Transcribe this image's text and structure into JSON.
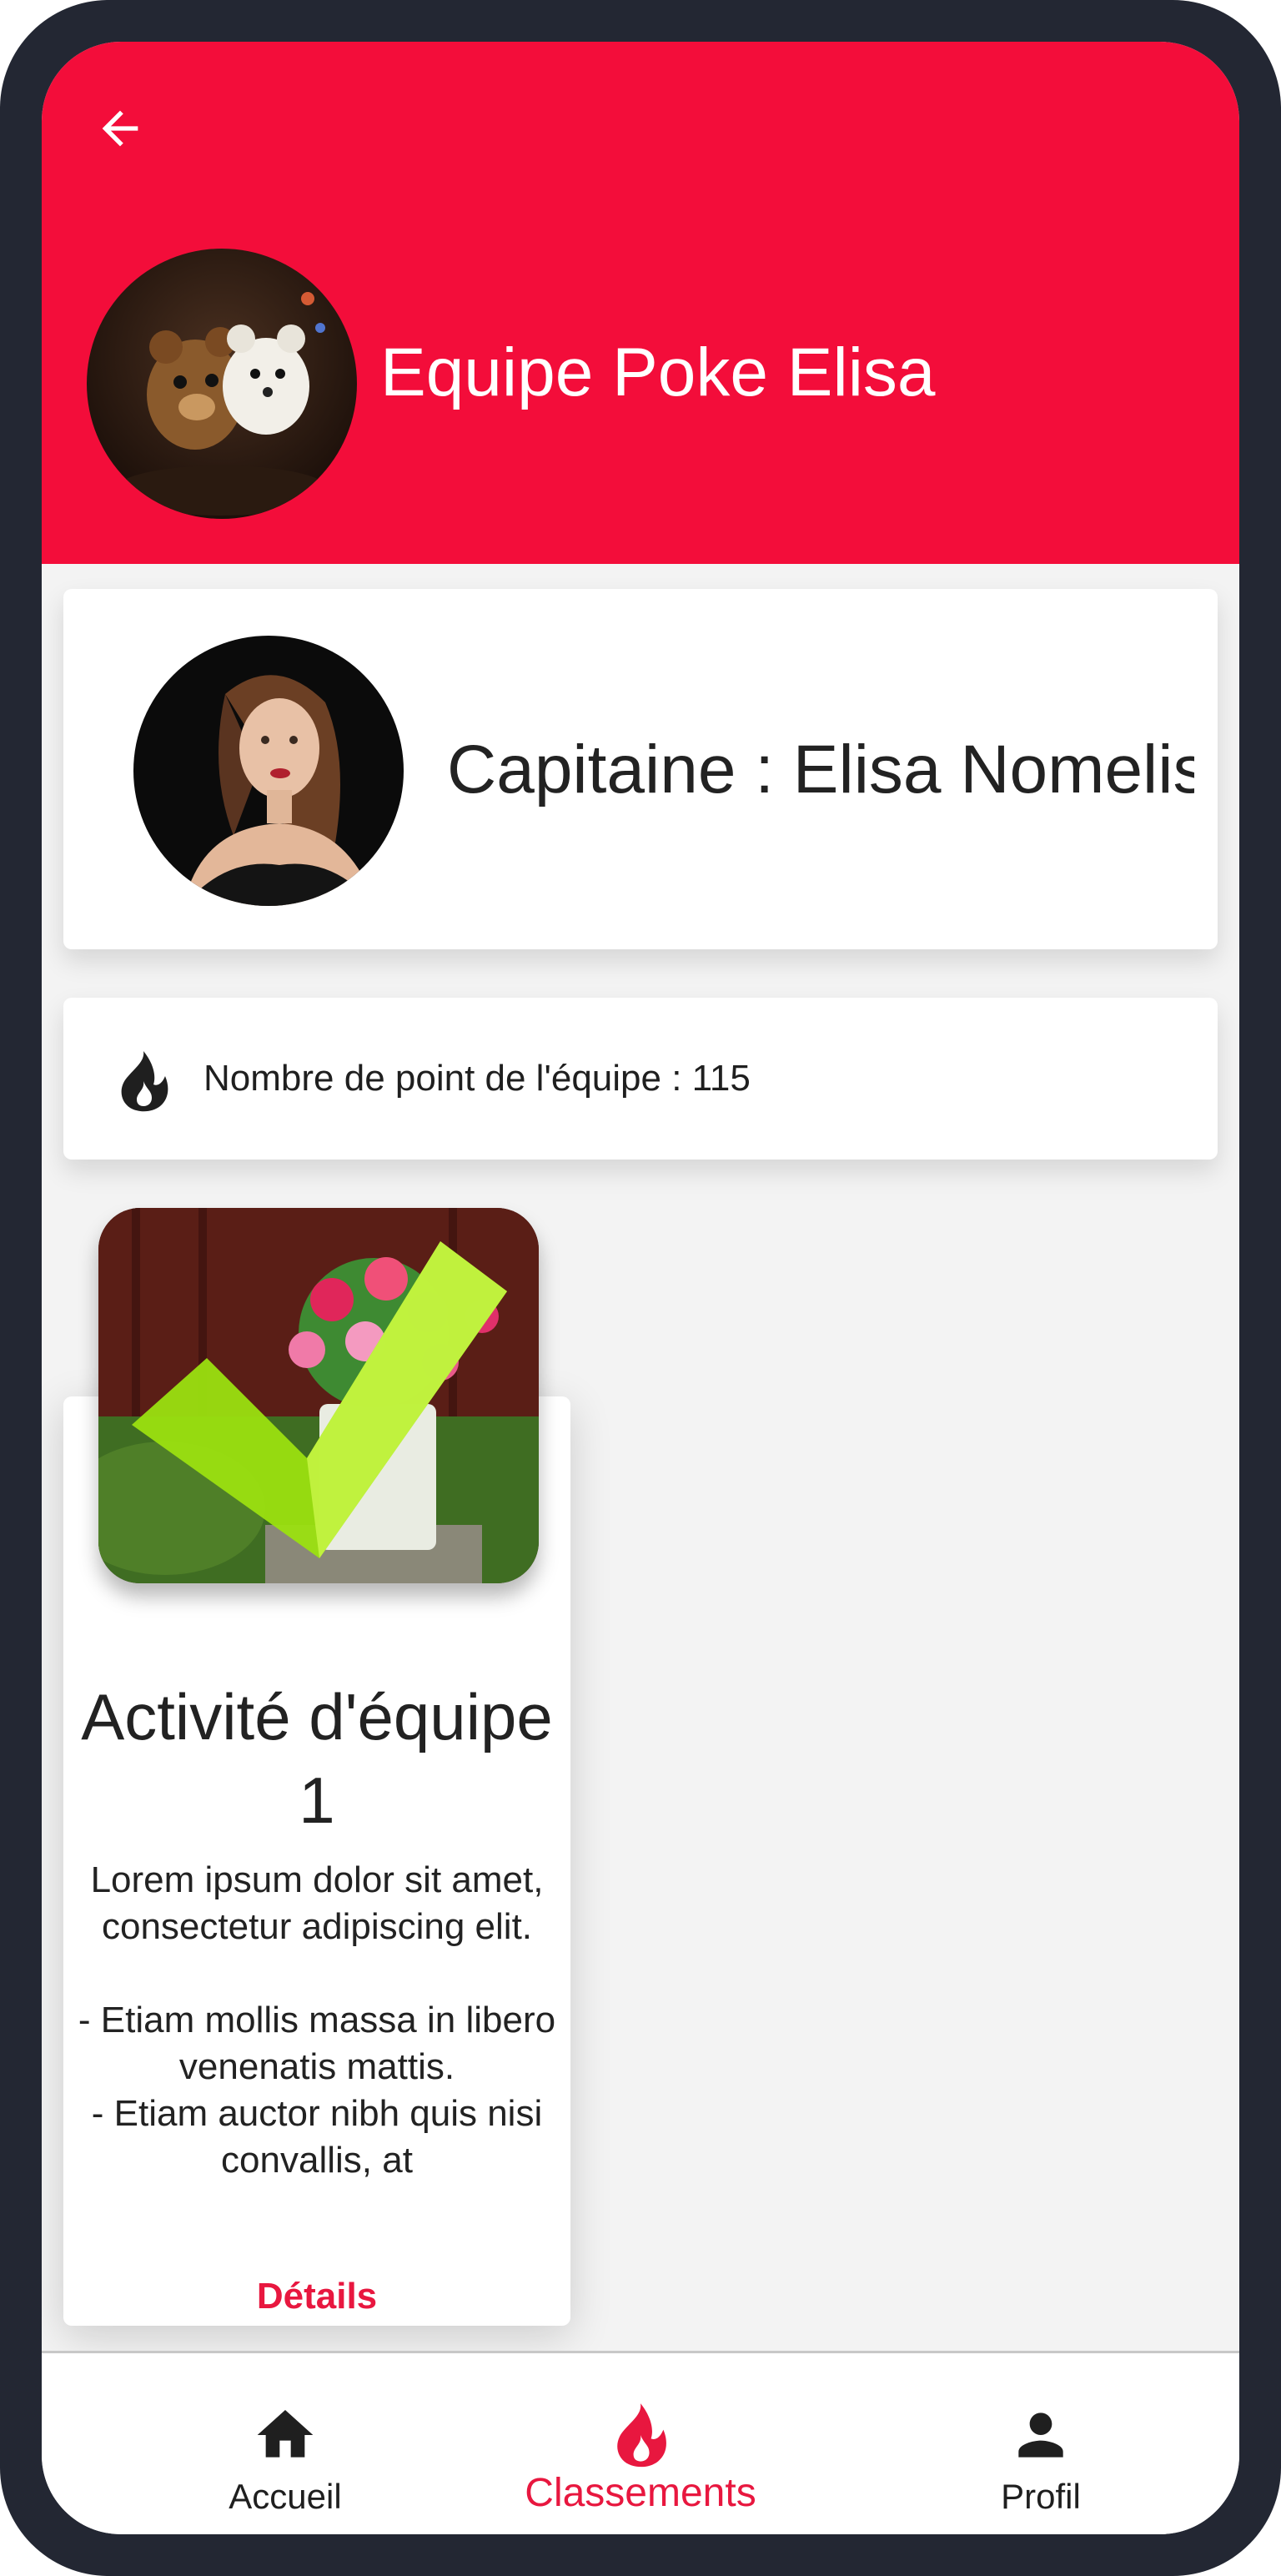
{
  "header": {
    "team_name": "Equipe Poke Elisa",
    "background_color": "#f30d3a"
  },
  "captain": {
    "text": "Capitaine : Elisa Nomelis"
  },
  "points": {
    "text": "Nombre de point de l'équipe : 115"
  },
  "activity": {
    "title": "Activité d'équipe 1",
    "description": "Lorem ipsum dolor sit amet, consectetur adipiscing elit.\n\n- Etiam mollis massa in libero venenatis mattis.\n- Etiam auctor nibh quis nisi convallis, at",
    "details_label": "Détails",
    "completed": true
  },
  "bottom_nav": {
    "items": [
      {
        "label": "Accueil",
        "icon": "home-icon"
      },
      {
        "label": "Classements",
        "icon": "flame-icon",
        "active": true
      },
      {
        "label": "Profil",
        "icon": "person-icon"
      }
    ]
  },
  "colors": {
    "accent": "#e8173f",
    "frame": "#232733"
  }
}
